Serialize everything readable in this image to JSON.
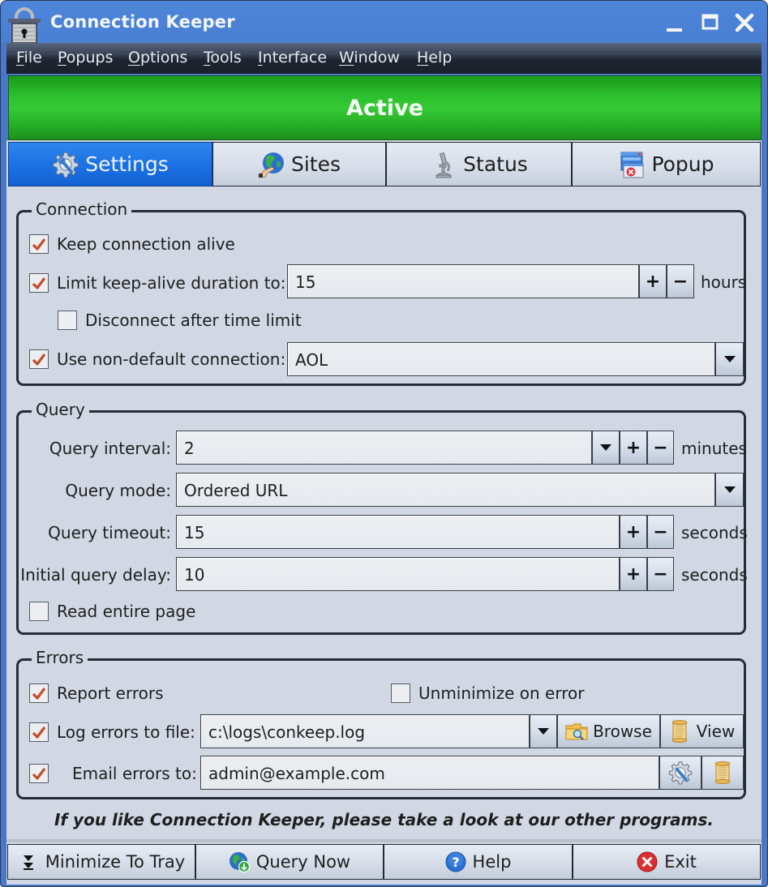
{
  "window": {
    "title": "Connection Keeper",
    "controls": {
      "minimize": "minimize",
      "maximize": "maximize",
      "close": "close"
    }
  },
  "menu": {
    "items": [
      {
        "label": "File",
        "accel": "F",
        "rest": "ile"
      },
      {
        "label": "Popups",
        "accel": "P",
        "rest": "opups"
      },
      {
        "label": "Options",
        "accel": "O",
        "rest": "ptions"
      },
      {
        "label": "Tools",
        "accel": "T",
        "rest": "ools"
      },
      {
        "label": "Interface",
        "accel": "I",
        "rest": "nterface"
      },
      {
        "label": "Window",
        "accel": "W",
        "rest": "indow"
      },
      {
        "label": "Help",
        "accel": "H",
        "rest": "elp"
      }
    ]
  },
  "status": {
    "text": "Active",
    "color": "#2cbf2c"
  },
  "tabs": [
    {
      "label": "Settings",
      "icon": "settings-gear-wrench-icon",
      "active": true
    },
    {
      "label": "Sites",
      "icon": "globe-hand-icon",
      "active": false
    },
    {
      "label": "Status",
      "icon": "microscope-icon",
      "active": false
    },
    {
      "label": "Popup",
      "icon": "popup-window-icon",
      "active": false
    }
  ],
  "connection": {
    "title": "Connection",
    "keep_alive": {
      "label": "Keep connection alive",
      "checked": true
    },
    "limit_duration": {
      "label": "Limit keep-alive duration to:",
      "checked": true,
      "value": "15",
      "unit": "hours"
    },
    "disconnect_after": {
      "label": "Disconnect after time limit",
      "checked": false
    },
    "non_default": {
      "label": "Use non-default connection:",
      "checked": true,
      "value": "AOL"
    }
  },
  "query": {
    "title": "Query",
    "interval": {
      "label": "Query interval:",
      "value": "2",
      "unit": "minutes"
    },
    "mode": {
      "label": "Query mode:",
      "value": "Ordered URL"
    },
    "timeout": {
      "label": "Query timeout:",
      "value": "15",
      "unit": "seconds"
    },
    "initial_delay": {
      "label": "Initial query delay:",
      "value": "10",
      "unit": "seconds"
    },
    "read_entire": {
      "label": "Read entire page",
      "checked": false
    }
  },
  "errors": {
    "title": "Errors",
    "report": {
      "label": "Report errors",
      "checked": true
    },
    "unminimize": {
      "label": "Unminimize on error",
      "checked": false
    },
    "log_file": {
      "label": "Log errors to file:",
      "checked": true,
      "value": "c:\\logs\\conkeep.log",
      "browse_label": "Browse",
      "view_label": "View"
    },
    "email": {
      "label": "Email errors to:",
      "checked": true,
      "value": "admin@example.com"
    }
  },
  "spin": {
    "plus": "+",
    "minus": "−"
  },
  "promo": "If you like Connection Keeper, please take a look at our other programs.",
  "bottom_buttons": [
    {
      "label": "Minimize To Tray",
      "icon": "double-chevron-down-icon"
    },
    {
      "label": "Query Now",
      "icon": "globe-download-icon"
    },
    {
      "label": "Help",
      "icon": "help-question-icon"
    },
    {
      "label": "Exit",
      "icon": "exit-x-icon"
    }
  ]
}
